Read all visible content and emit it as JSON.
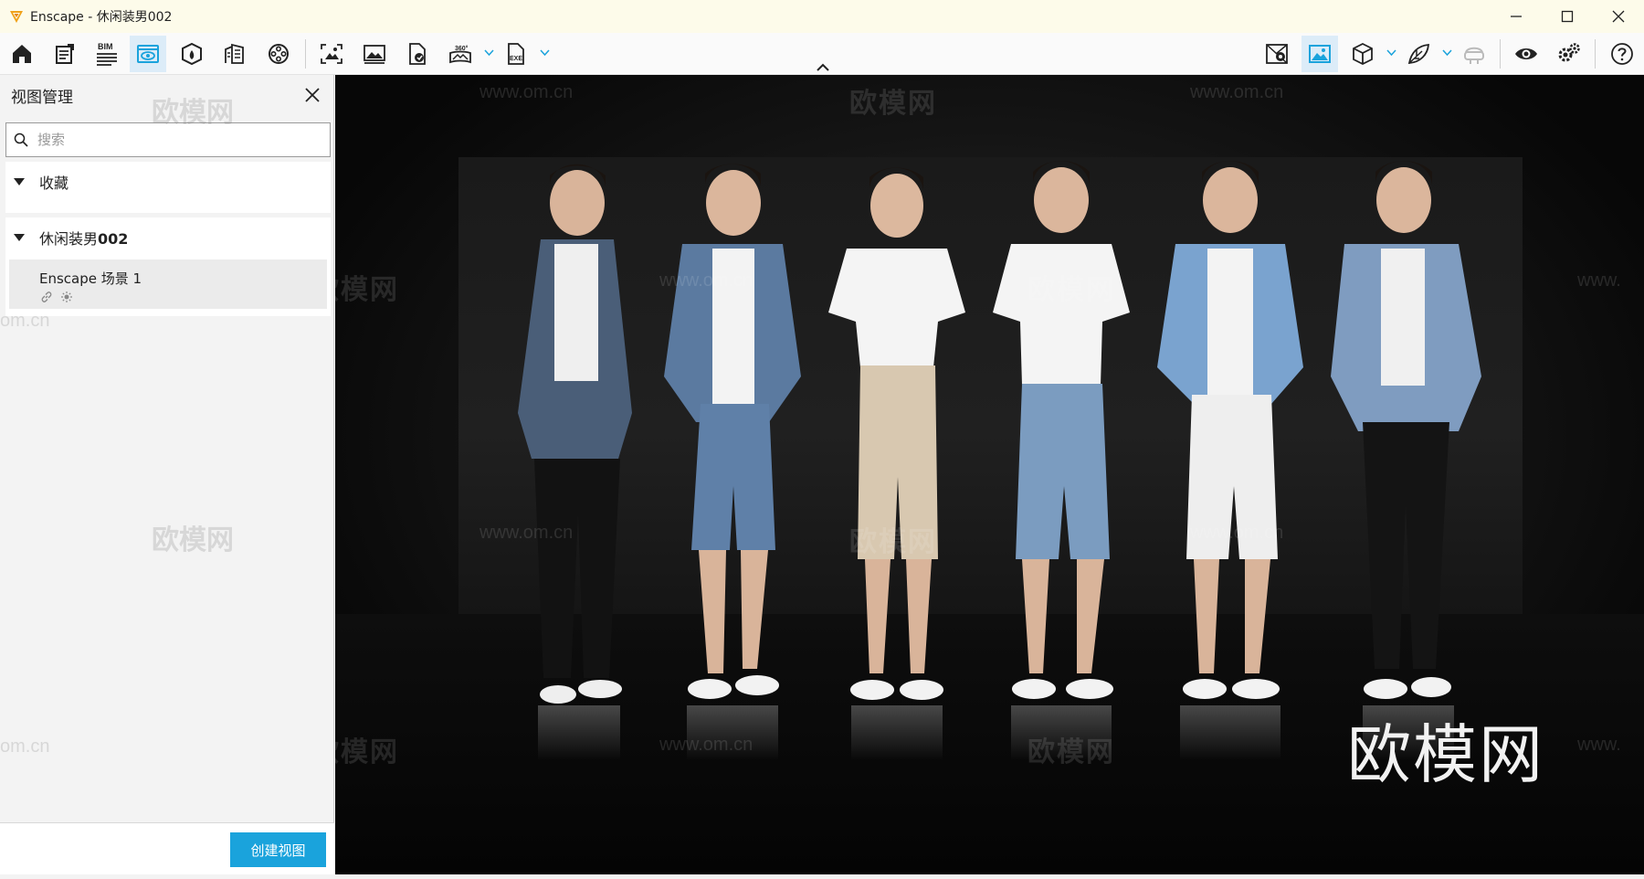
{
  "window": {
    "title": "Enscape - 休闲装男002",
    "controls": [
      "minimize-icon",
      "maximize-icon",
      "close-icon"
    ]
  },
  "toolbar": {
    "bim_label": "BIM",
    "pano_label": "360°",
    "exe_label": "EXE",
    "left_tools": [
      "home-icon",
      "document-icon",
      "bim-icon",
      "view-management-icon",
      "asset-library-icon",
      "building-icon",
      "video-reel-icon",
      "screenshot-icon",
      "image-icon",
      "export-icon",
      "panorama-icon",
      "exe-export-icon"
    ],
    "right_tools": [
      "map-icon",
      "rendering-icon",
      "cube-icon",
      "leaf-icon",
      "vr-headset-icon",
      "eye-icon",
      "settings-icon",
      "help-icon"
    ],
    "active": "view-management-icon",
    "accent": "#1aa3dc"
  },
  "panel": {
    "title": "视图管理",
    "search_placeholder": "搜索",
    "favorites_label": "收藏",
    "group_label_prefix": "休闲装男",
    "group_label_suffix": "002",
    "view_item_name": "Enscape 场景 1",
    "create_button": "创建视图"
  },
  "viewport": {
    "watermark_brand": "欧模网",
    "watermark_url": "www.om.cn",
    "watermark_url_partial": "www.",
    "watermark_url_cut": "om.cn",
    "logo_text": "欧模网"
  }
}
